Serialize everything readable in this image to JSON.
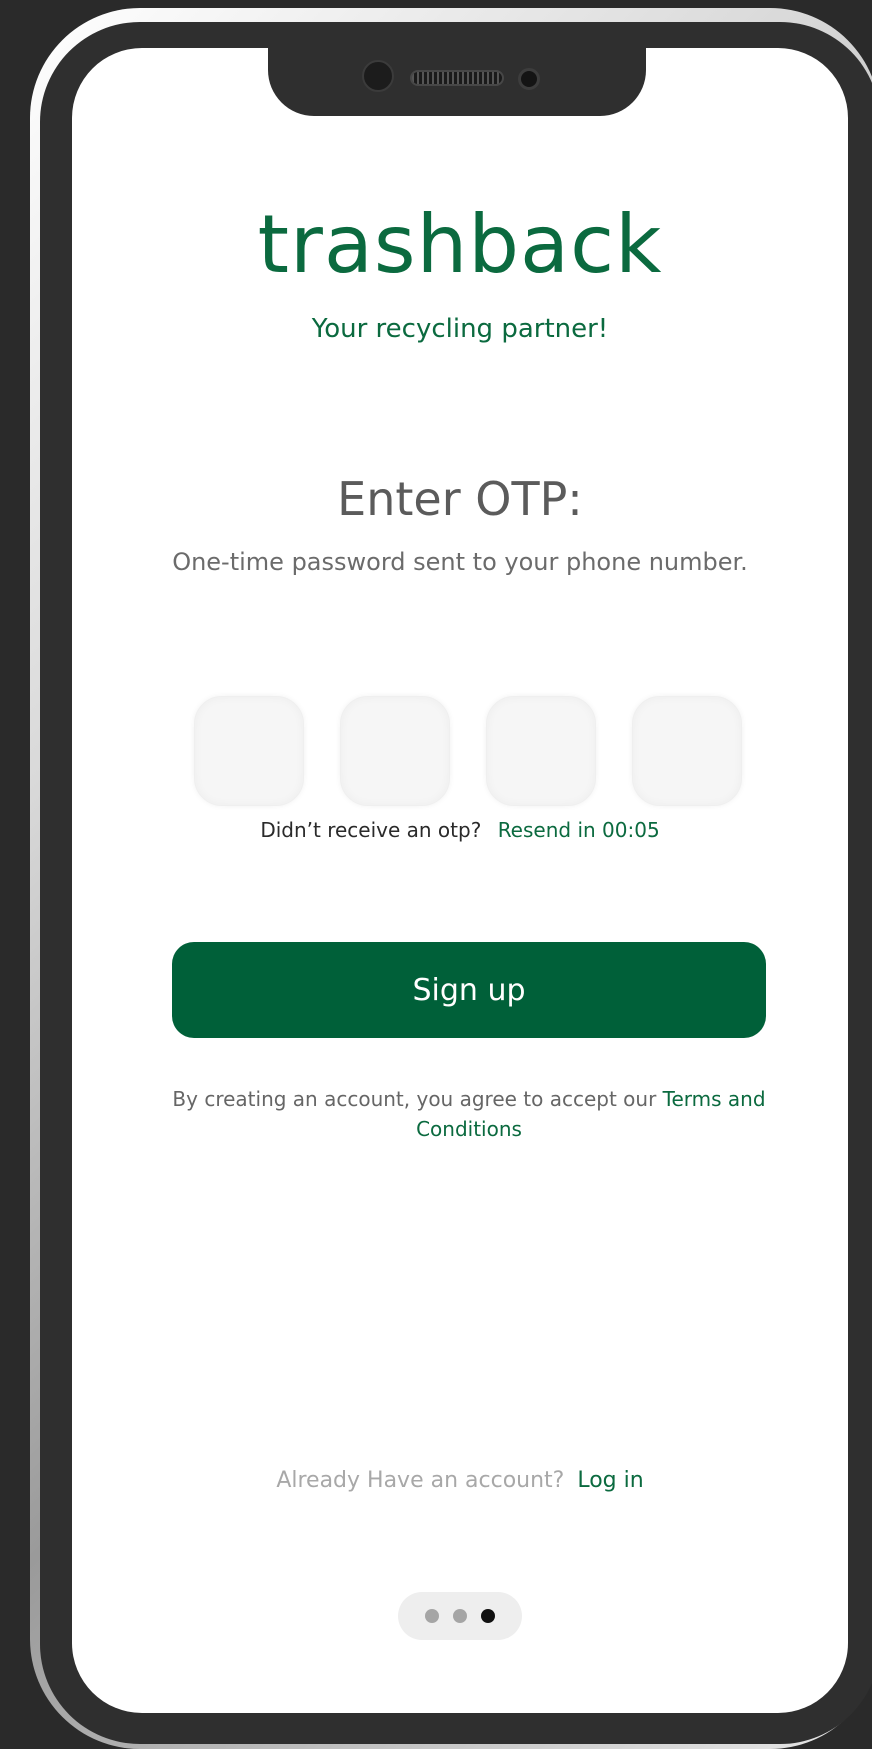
{
  "app": {
    "brand": "trashback",
    "tagline": "Your recycling partner!"
  },
  "otp": {
    "title": "Enter OTP:",
    "subtitle": "One-time password sent to your phone number.",
    "digits": [
      "",
      "",
      "",
      ""
    ],
    "resend_question": "Didn’t receive an otp?",
    "resend_link": "Resend in 00:05"
  },
  "signup": {
    "button_label": "Sign up"
  },
  "terms": {
    "text": "By creating an account, you agree to accept our",
    "link": "Terms and Conditions"
  },
  "login": {
    "question": "Already Have an account?",
    "link": "Log in"
  },
  "pager": {
    "count": 3,
    "active_index": 2
  },
  "colors": {
    "brand_green": "#0b6a3f",
    "button_green": "#006039",
    "background": "#ffffff",
    "frame": "#2a2a2a"
  },
  "icons": [
    "front-camera-icon",
    "speaker-grille-icon",
    "sensor-icon"
  ]
}
